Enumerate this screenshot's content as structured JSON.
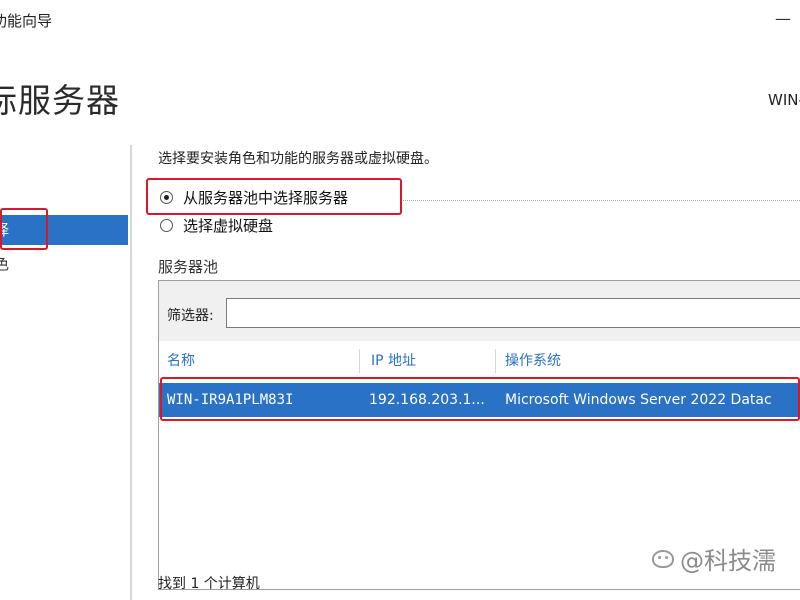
{
  "window": {
    "title": "功能向导",
    "minimize_glyph": "—"
  },
  "header": {
    "title": "标服务器",
    "server": "WIN-"
  },
  "sidebar": {
    "items": [
      {
        "label": "择",
        "active": true
      },
      {
        "label": "色",
        "active": false
      }
    ]
  },
  "main": {
    "instruction": "选择要安装角色和功能的服务器或虚拟硬盘。",
    "options": [
      {
        "label": "从服务器池中选择服务器",
        "checked": true
      },
      {
        "label": "选择虚拟硬盘",
        "checked": false
      }
    ],
    "pool_label": "服务器池",
    "filter": {
      "label": "筛选器:",
      "value": ""
    },
    "columns": [
      "名称",
      "IP 地址",
      "操作系统"
    ],
    "rows": [
      {
        "name": "WIN-IR9A1PLM83I",
        "ip": "192.168.203.1...",
        "os": "Microsoft Windows Server 2022 Datac"
      }
    ],
    "found_text": "找到 1 个计算机"
  },
  "watermark": {
    "text": "@科技濡"
  },
  "colors": {
    "accent": "#2a72c6",
    "highlight_box": "#d9182a"
  }
}
